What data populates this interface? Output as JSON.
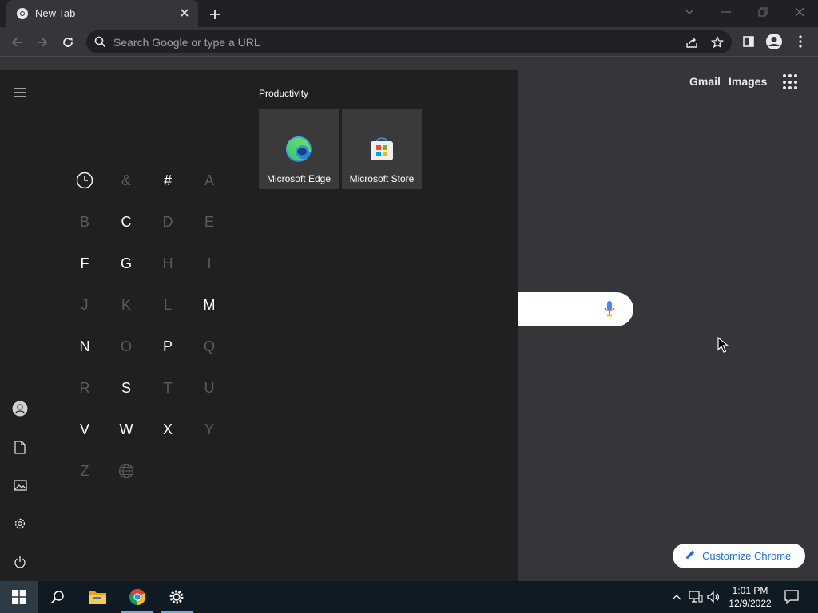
{
  "browser": {
    "tab": {
      "title": "New Tab"
    },
    "omnibox": {
      "placeholder": "Search Google or type a URL"
    }
  },
  "ntp": {
    "links": [
      "Gmail",
      "Images"
    ],
    "customize_label": "Customize Chrome"
  },
  "start_menu": {
    "letters": [
      {
        "label": "clock-icon",
        "active": true
      },
      {
        "label": "&",
        "active": false
      },
      {
        "label": "#",
        "active": true
      },
      {
        "label": "A",
        "active": false
      },
      {
        "label": "B",
        "active": false
      },
      {
        "label": "C",
        "active": true
      },
      {
        "label": "D",
        "active": false
      },
      {
        "label": "E",
        "active": false
      },
      {
        "label": "F",
        "active": true
      },
      {
        "label": "G",
        "active": true
      },
      {
        "label": "H",
        "active": false
      },
      {
        "label": "I",
        "active": false
      },
      {
        "label": "J",
        "active": false
      },
      {
        "label": "K",
        "active": false
      },
      {
        "label": "L",
        "active": false
      },
      {
        "label": "M",
        "active": true
      },
      {
        "label": "N",
        "active": true
      },
      {
        "label": "O",
        "active": false
      },
      {
        "label": "P",
        "active": true
      },
      {
        "label": "Q",
        "active": false
      },
      {
        "label": "R",
        "active": false
      },
      {
        "label": "S",
        "active": true
      },
      {
        "label": "T",
        "active": false
      },
      {
        "label": "U",
        "active": false
      },
      {
        "label": "V",
        "active": true
      },
      {
        "label": "W",
        "active": true
      },
      {
        "label": "X",
        "active": true
      },
      {
        "label": "Y",
        "active": false
      },
      {
        "label": "Z",
        "active": false
      },
      {
        "label": "globe-icon",
        "active": false
      }
    ],
    "group_label": "Productivity",
    "tiles": [
      {
        "label": "Microsoft Edge",
        "icon": "edge-icon"
      },
      {
        "label": "Microsoft Store",
        "icon": "store-icon"
      }
    ],
    "rail_icons": [
      "menu-icon",
      "user-icon",
      "documents-icon",
      "pictures-icon",
      "settings-icon",
      "power-icon"
    ]
  },
  "taskbar": {
    "time": "1:01 PM",
    "date": "12/9/2022",
    "apps": [
      "start-icon",
      "search-icon",
      "file-explorer-icon",
      "chrome-icon",
      "settings-icon"
    ]
  },
  "colors": {
    "accent_blue": "#1a73e8",
    "start_bg": "#202020",
    "tile_bg": "#3a3a3a",
    "ntp_bg": "#35363a",
    "taskbar_bg": "#101a22"
  }
}
